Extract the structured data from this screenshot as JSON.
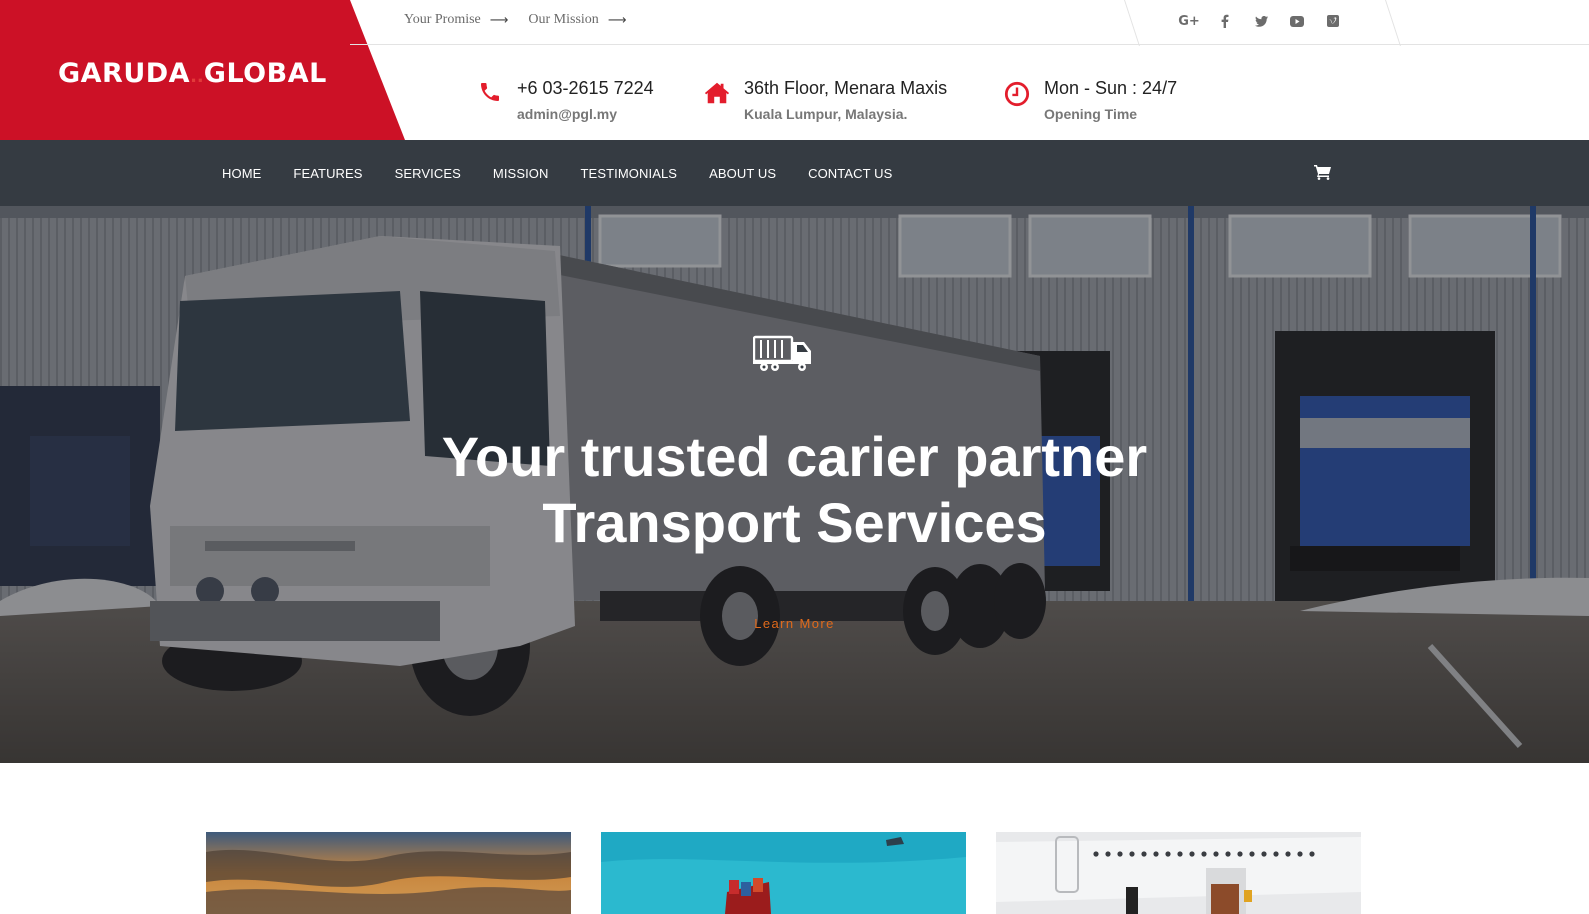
{
  "brand": {
    "name_part1": "GARUDA",
    "name_dots": "..",
    "name_part2": "GLOBAL"
  },
  "top_links": [
    {
      "label": "Your Promise",
      "icon": "arrow-right-icon"
    },
    {
      "label": "Our Mission",
      "icon": "arrow-right-icon"
    }
  ],
  "social_icons": [
    "google-plus-icon",
    "facebook-icon",
    "twitter-icon",
    "youtube-icon",
    "vimeo-icon"
  ],
  "contact": {
    "phone": {
      "line1": "+6 03-2615 7224",
      "line2": "admin@pgl.my",
      "icon": "phone-icon"
    },
    "address": {
      "line1": "36th Floor, Menara Maxis",
      "line2": "Kuala Lumpur, Malaysia.",
      "icon": "home-icon"
    },
    "hours": {
      "line1": "Mon - Sun : 24/7",
      "line2": "Opening Time",
      "icon": "clock-icon"
    }
  },
  "nav": {
    "items": [
      "HOME",
      "FEATURES",
      "SERVICES",
      "MISSION",
      "TESTIMONIALS",
      "ABOUT US",
      "CONTACT US"
    ],
    "cart_icon": "cart-icon"
  },
  "hero": {
    "icon": "truck-icon",
    "title_line1": "Your trusted carier partner",
    "title_line2": "Transport Services",
    "cta": "Learn More"
  },
  "cards": [
    {
      "name": "sunset-sky-card"
    },
    {
      "name": "cargo-ship-card"
    },
    {
      "name": "airplane-cargo-card"
    }
  ],
  "colors": {
    "brand_red": "#cc1126",
    "nav_bg": "#353b42",
    "cta_orange": "#e06a1b",
    "icon_red": "#e31d2c"
  }
}
